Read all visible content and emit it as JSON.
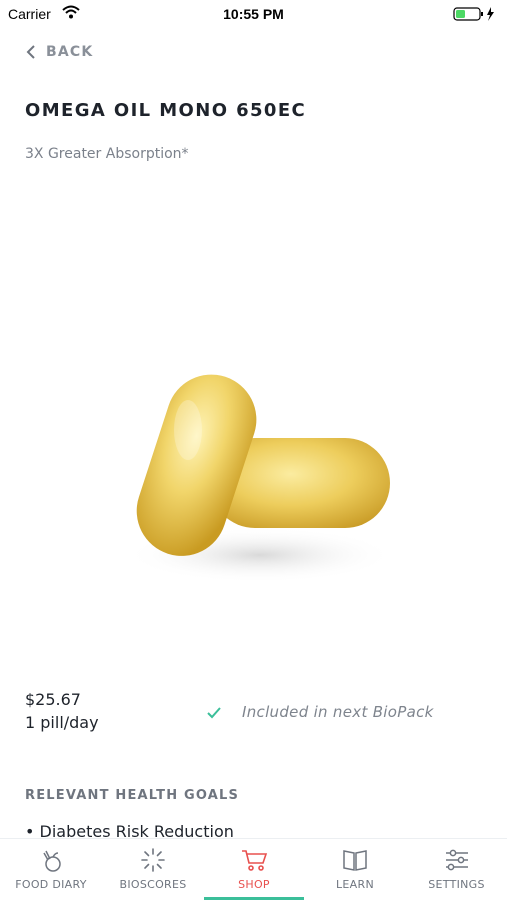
{
  "status_bar": {
    "carrier": "Carrier",
    "time": "10:55 PM",
    "battery_color": "#4cd964"
  },
  "nav": {
    "back_label": "BACK"
  },
  "product": {
    "title": "OMEGA OIL MONO 650EC",
    "subtitle": "3X Greater Absorption*",
    "price": "$25.67",
    "dosage": "1 pill/day",
    "included_text": "Included in next BioPack"
  },
  "health_goals": {
    "header": "RELEVANT HEALTH GOALS",
    "items": [
      "Diabetes Risk Reduction"
    ]
  },
  "tab_bar": {
    "active_color": "#e8514f",
    "indicator_color": "#3bbf9a",
    "tabs": [
      {
        "label": "FOOD DIARY",
        "icon": "food-diary-icon"
      },
      {
        "label": "BIOSCORES",
        "icon": "bioscores-icon"
      },
      {
        "label": "SHOP",
        "icon": "cart-icon"
      },
      {
        "label": "LEARN",
        "icon": "book-icon"
      },
      {
        "label": "SETTINGS",
        "icon": "sliders-icon"
      }
    ]
  }
}
